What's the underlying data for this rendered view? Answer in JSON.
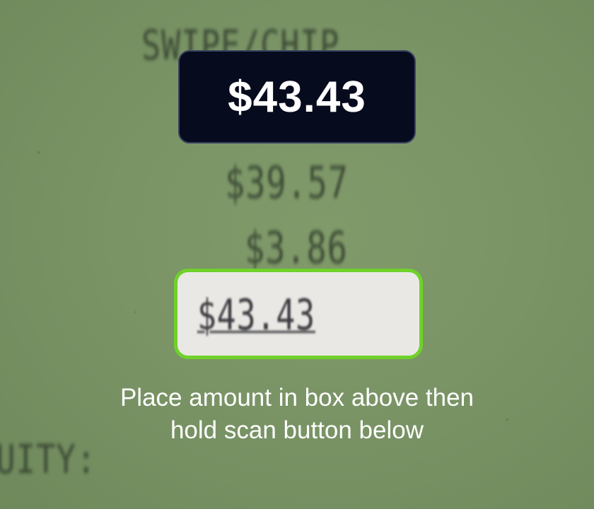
{
  "camera_view": {
    "receipt_lines": {
      "top": "SWIPE/CHIP",
      "subtotal": "$39.57",
      "tax": "$3.86",
      "bottom": "UITY:"
    }
  },
  "detected_amount": "$43.43",
  "scan_box": {
    "text": "$43.43"
  },
  "instruction": {
    "line1": "Place amount in box above then",
    "line2": "hold scan button below"
  },
  "colors": {
    "camera_background": "#7a9466",
    "detected_pill": "#070b1e",
    "scan_box_border": "#6fd12a",
    "scan_box_fill": "#eae8e4",
    "instruction_text": "#ffffff"
  }
}
